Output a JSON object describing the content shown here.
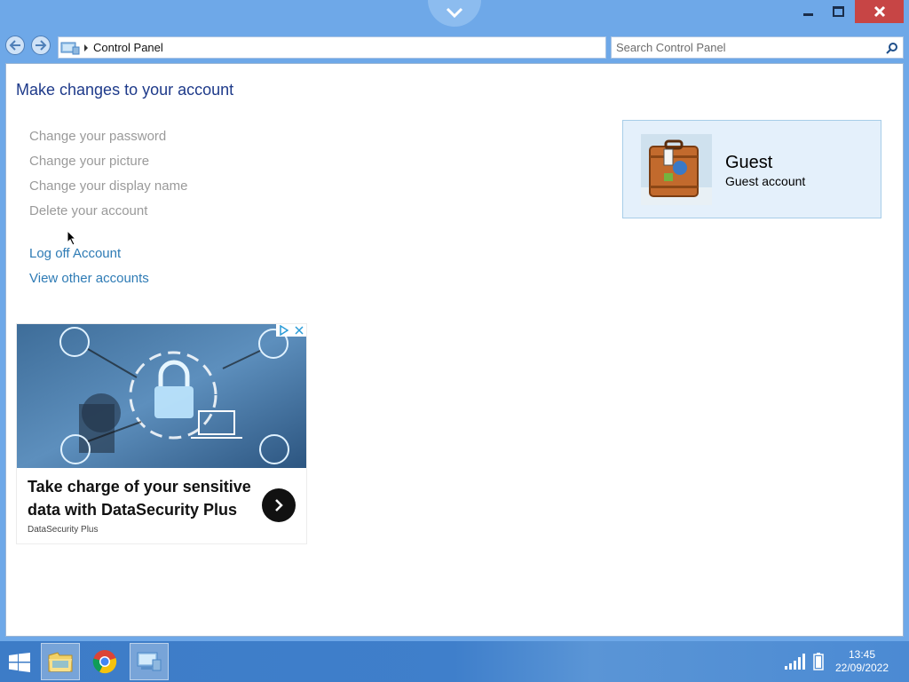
{
  "window": {
    "address": "Control Panel",
    "search_placeholder": "Search Control Panel"
  },
  "page": {
    "title": "Make changes to your account",
    "tasks": [
      "Change your password",
      "Change your picture",
      "Change your display name",
      "Delete your account"
    ],
    "links": [
      "Log off Account",
      "View other accounts"
    ]
  },
  "account": {
    "name": "Guest",
    "type": "Guest account"
  },
  "ad": {
    "headline": "Take charge of your sensitive data with DataSecurity Plus",
    "source": "DataSecurity Plus"
  },
  "taskbar": {
    "time": "13:45",
    "date": "22/09/2022"
  },
  "colors": {
    "window_frame": "#6ea8e8",
    "close_button": "#c74545",
    "title_text": "#1e3a8a",
    "link_text": "#2e7bb5",
    "disabled_text": "#9a9a9a",
    "card_bg": "#e4f0fb"
  },
  "icons": [
    "chevron-down-icon",
    "minimize-icon",
    "maximize-icon",
    "close-icon",
    "back-arrow-icon",
    "forward-arrow-icon",
    "control-panel-icon",
    "search-icon",
    "start-windows-icon",
    "file-explorer-icon",
    "chrome-icon",
    "signal-icon",
    "battery-icon",
    "mouse-cursor-icon"
  ]
}
